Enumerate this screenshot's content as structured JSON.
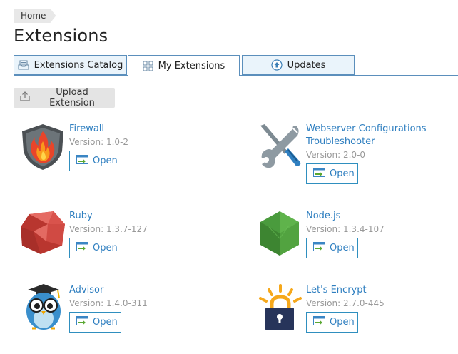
{
  "breadcrumb": {
    "home": "Home"
  },
  "page_title": "Extensions",
  "tabs": [
    {
      "label": "Extensions Catalog",
      "icon": "catalog-icon",
      "active": false
    },
    {
      "label": "My Extensions",
      "icon": "grid-icon",
      "active": true
    },
    {
      "label": "Updates",
      "icon": "upload-arrow-icon",
      "active": false
    }
  ],
  "toolbar": {
    "upload_label": "Upload Extension"
  },
  "version_prefix": "Version: ",
  "open_label": "Open",
  "extensions": [
    {
      "name": "Firewall",
      "version": "1.0-2",
      "icon": "firewall-icon"
    },
    {
      "name": "Webserver Configurations Troubleshooter",
      "version": "2.0-0",
      "icon": "tools-icon"
    },
    {
      "name": "Ruby",
      "version": "1.3.7-127",
      "icon": "ruby-icon"
    },
    {
      "name": "Node.js",
      "version": "1.3.4-107",
      "icon": "nodejs-icon"
    },
    {
      "name": "Advisor",
      "version": "1.4.0-311",
      "icon": "owl-icon"
    },
    {
      "name": "Let's Encrypt",
      "version": "2.7.0-445",
      "icon": "padlock-icon"
    }
  ],
  "colors": {
    "link": "#2f7fc0",
    "tab_border": "#5b8fbc",
    "tab_bg": "#eaf4fb",
    "muted": "#999999"
  }
}
